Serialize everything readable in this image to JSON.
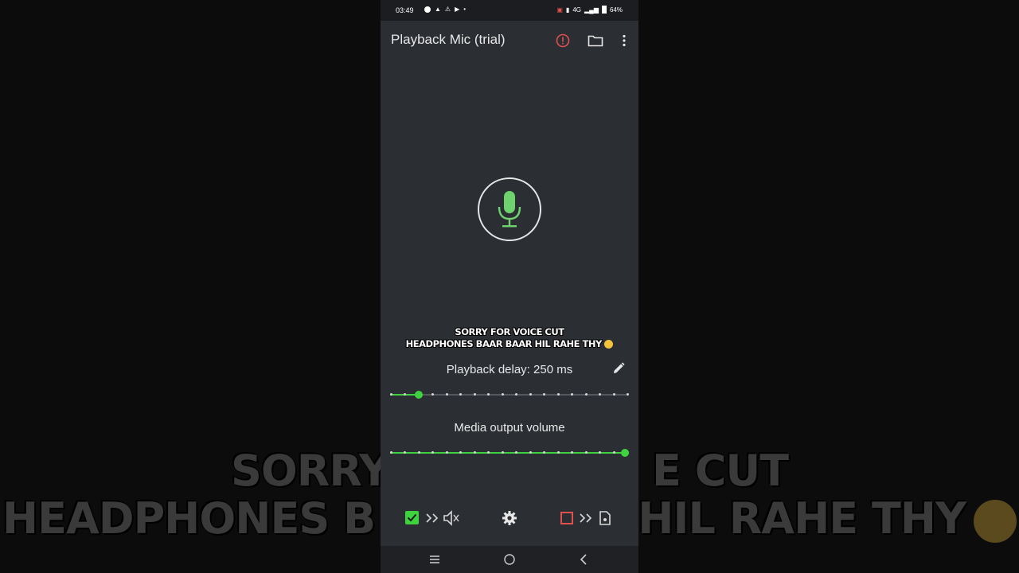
{
  "status_bar": {
    "time": "03:49",
    "network": "4G",
    "battery": "64%"
  },
  "app_bar": {
    "title": "Playback Mic (trial)"
  },
  "overlay_caption": {
    "line1": "SORRY FOR VOICE CUT",
    "line2": "HEADPHONES BAAR BAAR HIL RAHE THY"
  },
  "background_caption": {
    "line1_left": "SORRY",
    "line1_right": "E CUT",
    "line2_left": "HEADPHONES B",
    "line2_right": "HIL RAHE THY"
  },
  "delay": {
    "label": "Playback delay: 250 ms",
    "fraction": 0.12
  },
  "volume": {
    "label": "Media output volume",
    "fraction": 1.0
  },
  "bottom_controls": {
    "speaker_output_checked": true,
    "file_output_checked": false
  },
  "colors": {
    "accent": "#3ed23e",
    "alert": "#e0504f",
    "background": "#2b2e33"
  },
  "icons": [
    "alert-icon",
    "folder-icon",
    "more-icon",
    "mic-icon",
    "edit-icon",
    "speaker-muted-icon",
    "gear-icon",
    "file-icon"
  ]
}
